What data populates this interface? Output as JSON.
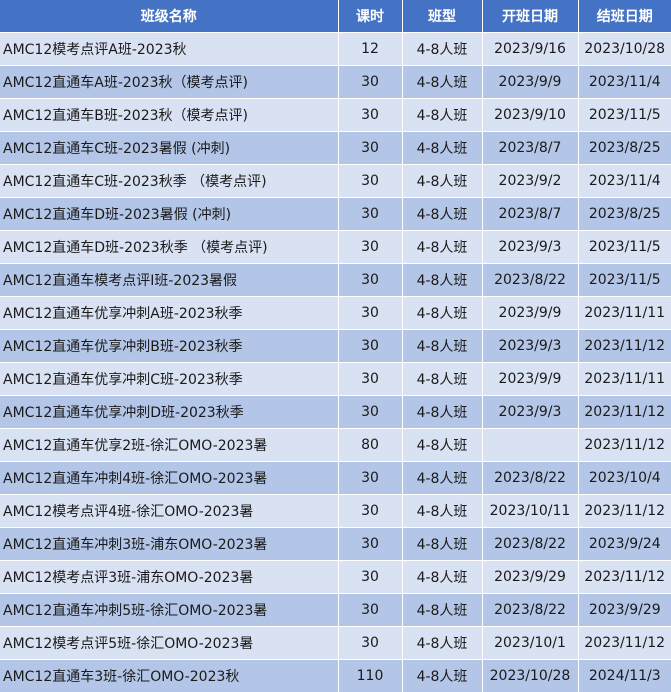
{
  "headers": [
    "班级名称",
    "课时",
    "班型",
    "开班日期",
    "结班日期"
  ],
  "rows": [
    [
      "AMC12模考点评A班-2023秋",
      "12",
      "4-8人班",
      "2023/9/16",
      "2023/10/28"
    ],
    [
      "AMC12直通车A班-2023秋（模考点评)",
      "30",
      "4-8人班",
      "2023/9/9",
      "2023/11/4"
    ],
    [
      "AMC12直通车B班-2023秋（模考点评)",
      "30",
      "4-8人班",
      "2023/9/10",
      "2023/11/5"
    ],
    [
      "AMC12直通车C班-2023暑假 (冲刺)",
      "30",
      "4-8人班",
      "2023/8/7",
      "2023/8/25"
    ],
    [
      "AMC12直通车C班-2023秋季 （模考点评)",
      "30",
      "4-8人班",
      "2023/9/2",
      "2023/11/4"
    ],
    [
      "AMC12直通车D班-2023暑假 (冲刺)",
      "30",
      "4-8人班",
      "2023/8/7",
      "2023/8/25"
    ],
    [
      "AMC12直通车D班-2023秋季 （模考点评)",
      "30",
      "4-8人班",
      "2023/9/3",
      "2023/11/5"
    ],
    [
      "AMC12直通车模考点评I班-2023暑假",
      "30",
      "4-8人班",
      "2023/8/22",
      "2023/11/5"
    ],
    [
      "AMC12直通车优享冲刺A班-2023秋季",
      "30",
      "4-8人班",
      "2023/9/9",
      "2023/11/11"
    ],
    [
      "AMC12直通车优享冲刺B班-2023秋季",
      "30",
      "4-8人班",
      "2023/9/3",
      "2023/11/12"
    ],
    [
      "AMC12直通车优享冲刺C班-2023秋季",
      "30",
      "4-8人班",
      "2023/9/9",
      "2023/11/11"
    ],
    [
      "AMC12直通车优享冲刺D班-2023秋季",
      "30",
      "4-8人班",
      "2023/9/3",
      "2023/11/12"
    ],
    [
      "AMC12直通车优享2班-徐汇OMO-2023暑",
      "80",
      "4-8人班",
      "",
      "2023/11/12"
    ],
    [
      "AMC12直通车冲刺4班-徐汇OMO-2023暑",
      "30",
      "4-8人班",
      "2023/8/22",
      "2023/10/4"
    ],
    [
      "AMC12模考点评4班-徐汇OMO-2023暑",
      "30",
      "4-8人班",
      "2023/10/11",
      "2023/11/12"
    ],
    [
      "AMC12直通车冲刺3班-浦东OMO-2023暑",
      "30",
      "4-8人班",
      "2023/8/22",
      "2023/9/24"
    ],
    [
      "AMC12模考点评3班-浦东OMO-2023暑",
      "30",
      "4-8人班",
      "2023/9/29",
      "2023/11/12"
    ],
    [
      "AMC12直通车冲刺5班-徐汇OMO-2023暑",
      "30",
      "4-8人班",
      "2023/8/22",
      "2023/9/29"
    ],
    [
      "AMC12模考点评5班-徐汇OMO-2023暑",
      "30",
      "4-8人班",
      "2023/10/1",
      "2023/11/12"
    ],
    [
      "AMC12直通车3班-徐汇OMO-2023秋",
      "110",
      "4-8人班",
      "2023/10/28",
      "2024/11/3"
    ]
  ]
}
